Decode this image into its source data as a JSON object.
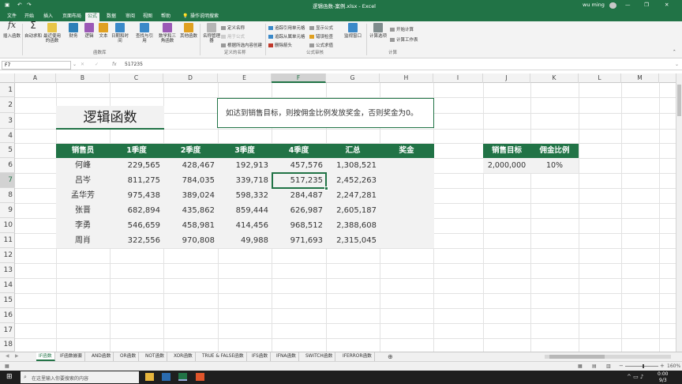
{
  "window": {
    "title": "逻辑函数-案例.xlsx - Excel",
    "user": "wu ming",
    "share": "共享",
    "minimize": "—",
    "restore": "❐",
    "close": "✕"
  },
  "ribbon_tabs": [
    {
      "label": "文件"
    },
    {
      "label": "开始"
    },
    {
      "label": "插入"
    },
    {
      "label": "页面布局"
    },
    {
      "label": "公式"
    },
    {
      "label": "数据"
    },
    {
      "label": "审阅"
    },
    {
      "label": "视图"
    },
    {
      "label": "帮助"
    },
    {
      "label": "操作说明搜索"
    }
  ],
  "ribbon": {
    "insert_function": "插入函数",
    "autosum": "自动求和",
    "recent": "最近使用的函数",
    "financial": "财务",
    "logical": "逻辑",
    "text": "文本",
    "datetime": "日期和时间",
    "lookup": "查找与引用",
    "math": "数学和三角函数",
    "other": "其他函数",
    "group_library": "函数库",
    "name_manager": "名称管理器",
    "define_name": "定义名称",
    "use_in_formula": "用于公式",
    "create_from_sel": "根据所选内容创建",
    "group_names": "定义的名称",
    "trace_prec": "追踪引用单元格",
    "trace_dep": "追踪从属单元格",
    "remove_arrows": "删除箭头",
    "show_formulas": "显示公式",
    "error_check": "错误检查",
    "eval_formula": "公式求值",
    "watch": "监视窗口",
    "group_audit": "公式审核",
    "calc_options": "计算选项",
    "calc_now": "开始计算",
    "calc_sheet": "计算工作表",
    "group_calc": "计算"
  },
  "formula_bar": {
    "name_box": "F7",
    "fx": "fx",
    "value": "517235"
  },
  "columns": [
    "A",
    "B",
    "C",
    "D",
    "E",
    "F",
    "G",
    "H",
    "I",
    "J",
    "K",
    "L",
    "M"
  ],
  "rows": [
    "1",
    "2",
    "3",
    "4",
    "5",
    "6",
    "7",
    "8",
    "9",
    "10",
    "11",
    "12",
    "13",
    "14",
    "15",
    "16",
    "17",
    "18"
  ],
  "sheet": {
    "title": "逻辑函数",
    "note": "如达到销售目标，则按佣金比例发放奖金，否则奖金为0。",
    "headers": [
      "销售员",
      "1季度",
      "2季度",
      "3季度",
      "4季度",
      "汇总",
      "奖金"
    ],
    "data": [
      [
        "何峰",
        "229,565",
        "428,467",
        "192,913",
        "457,576",
        "1,308,521",
        ""
      ],
      [
        "吕岑",
        "811,275",
        "784,035",
        "339,718",
        "517,235",
        "2,452,263",
        ""
      ],
      [
        "孟华芳",
        "975,438",
        "389,024",
        "598,332",
        "284,487",
        "2,247,281",
        ""
      ],
      [
        "张晋",
        "682,894",
        "435,862",
        "859,444",
        "626,987",
        "2,605,187",
        ""
      ],
      [
        "李勇",
        "546,659",
        "458,981",
        "414,456",
        "968,512",
        "2,388,608",
        ""
      ],
      [
        "周肖",
        "322,556",
        "970,808",
        "49,988",
        "971,693",
        "2,315,045",
        ""
      ]
    ],
    "target_headers": [
      "销售目标",
      "佣金比例"
    ],
    "target_values": [
      "2,000,000",
      "10%"
    ]
  },
  "sheet_tabs": [
    {
      "label": "IF函数"
    },
    {
      "label": "IF函数嵌套"
    },
    {
      "label": "AND函数"
    },
    {
      "label": "OR函数"
    },
    {
      "label": "NOT函数"
    },
    {
      "label": "XOR函数"
    },
    {
      "label": "TRUE & FALSE函数"
    },
    {
      "label": "IFS函数"
    },
    {
      "label": "IFNA函数"
    },
    {
      "label": "SWITCH函数"
    },
    {
      "label": "IFERROR函数"
    }
  ],
  "status": {
    "zoom": "160%",
    "add_sheet": "⊕"
  },
  "taskbar": {
    "search_placeholder": "在这里输入你要搜索的内容",
    "time": "0:00",
    "date": "9/3"
  },
  "colors": {
    "excel_green": "#217346",
    "table_header_bg": "#217346",
    "table_row_bg": "#f2f2f2"
  }
}
